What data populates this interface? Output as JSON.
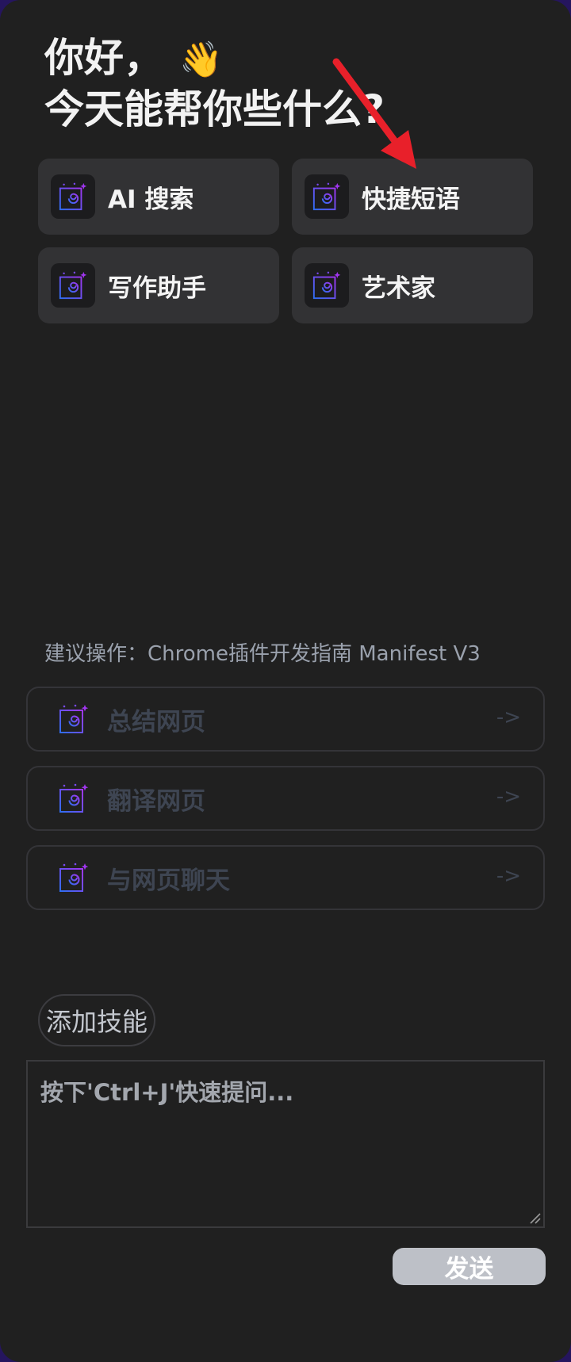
{
  "greeting": {
    "line1": "你好，",
    "wave_emoji": "👋",
    "line2": "今天能帮你些什么?"
  },
  "skills": [
    {
      "label": "AI 搜索",
      "icon": "skill-logo-icon"
    },
    {
      "label": "快捷短语",
      "icon": "skill-logo-icon"
    },
    {
      "label": "写作助手",
      "icon": "skill-logo-icon"
    },
    {
      "label": "艺术家",
      "icon": "skill-logo-icon"
    }
  ],
  "suggestions": {
    "title": "建议操作：Chrome插件开发指南 Manifest V3",
    "items": [
      {
        "label": "总结网页",
        "arrow": "->"
      },
      {
        "label": "翻译网页",
        "arrow": "->"
      },
      {
        "label": "与网页聊天",
        "arrow": "->"
      }
    ]
  },
  "add_skill_label": "添加技能",
  "input": {
    "placeholder": "按下'Ctrl+J'快速提问...",
    "value": ""
  },
  "send_label": "发送",
  "colors": {
    "panel_bg": "#202020",
    "card_bg": "#323234",
    "icon_blue": "#3b6cf0",
    "icon_purple": "#9a3bf0",
    "annotation_red": "#e8202a",
    "send_bg": "#bdc0c7"
  }
}
